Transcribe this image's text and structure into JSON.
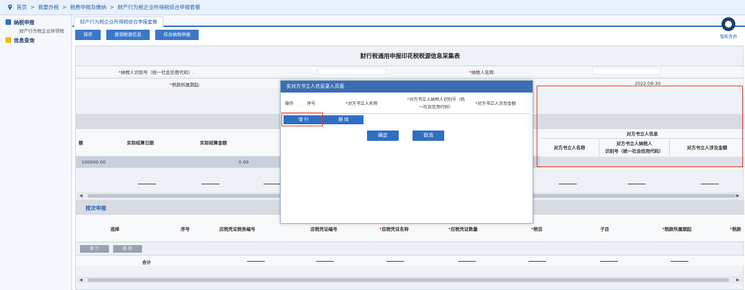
{
  "breadcrumb": [
    "首页",
    "我要办税",
    "税费申报及缴纳",
    "财产行为税企业所得税综合申报套餐"
  ],
  "breadcrumb_sep": ">",
  "sidebar": {
    "groups": [
      {
        "label": "纳税申报",
        "sub": [
          "财产行为税企业所得税"
        ]
      },
      {
        "label": "信息查询",
        "sub": []
      }
    ]
  },
  "tab": {
    "label": "财产行为税企业所得税综合申报套餐"
  },
  "helper": {
    "label": "智能咨询"
  },
  "toolbar": {
    "save": "保存",
    "query": "查询税源信息",
    "combined": "综合纳税申报"
  },
  "sheet": {
    "title": "财行税通用申报印花税税源信息采集表",
    "taxpayer_id_label": "纳税人识别号（统一社会信用代码）:",
    "taxpayer_name_label": "纳税人名称:",
    "period_label": "税款所属期起:",
    "period_end_value": "2022-09-30",
    "req_mark": "*"
  },
  "table1": {
    "col_partial": "额",
    "col_settle_date": "实际结算日期",
    "col_settle_amount": "实际结算金额",
    "counterparty_group": "对方书立人信息",
    "cp_name": "对方书立人名称",
    "cp_id_line1": "对方书立人纳税人",
    "cp_id_line2": "识别号（统一社会信用代码）",
    "cp_amount": "对方书立人涉及金额",
    "row_value1": "100000.00",
    "row_value2": "0.00",
    "dash": "——"
  },
  "section2": {
    "title": "按次申报",
    "cols": [
      "选择",
      "序号",
      "应税凭证税务编号",
      "应税凭证编号",
      "应税凭证名称",
      "应税凭证数量",
      "税目",
      "子目",
      "税款所属期起",
      "税款"
    ],
    "req_cols": [
      false,
      false,
      false,
      false,
      true,
      true,
      true,
      false,
      true,
      true
    ],
    "add_btn": "增 行",
    "del_btn": "删 除",
    "total": "合计"
  },
  "modal": {
    "title": "实对方书立人信息录入页面",
    "col_op": "操作",
    "col_seq": "序号",
    "col_name": "对方书立人名称",
    "col_id_line1": "对方书立人纳税人识别号（统",
    "col_id_line2": "一社会信用代码）",
    "col_amount": "对方书立人涉及金额",
    "add": "增 行",
    "delete": "删 除",
    "confirm": "确定",
    "cancel": "取消"
  },
  "colors": {
    "primary": "#2f6fc3",
    "highlight": "#e23c2c",
    "warn": "#f2b705"
  }
}
